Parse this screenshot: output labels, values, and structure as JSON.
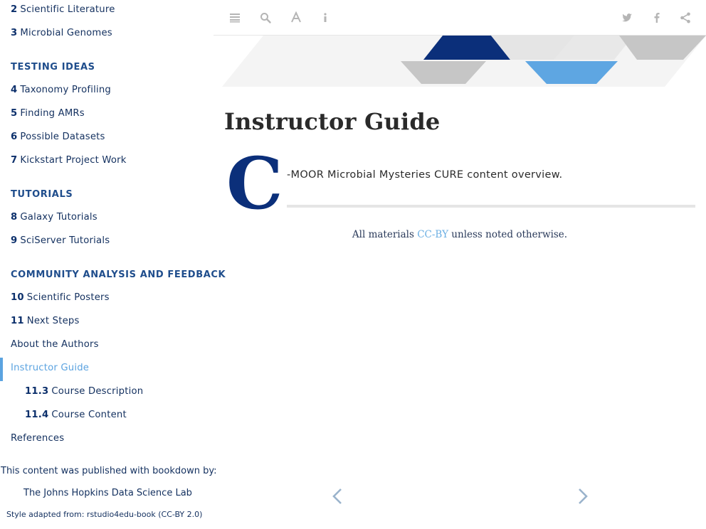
{
  "sidebar": {
    "chapters": [
      {
        "num": "2",
        "label": "Scientific Literature"
      },
      {
        "num": "3",
        "label": "Microbial Genomes"
      }
    ],
    "section_testing": "TESTING IDEAS",
    "testing": [
      {
        "num": "4",
        "label": "Taxonomy Profiling"
      },
      {
        "num": "5",
        "label": "Finding AMRs"
      },
      {
        "num": "6",
        "label": "Possible Datasets"
      },
      {
        "num": "7",
        "label": "Kickstart Project Work"
      }
    ],
    "section_tutorials": "TUTORIALS",
    "tutorials": [
      {
        "num": "8",
        "label": "Galaxy Tutorials"
      },
      {
        "num": "9",
        "label": "SciServer Tutorials"
      }
    ],
    "section_community": "COMMUNITY ANALYSIS AND FEEDBACK",
    "community": [
      {
        "num": "10",
        "label": "Scientific Posters"
      },
      {
        "num": "11",
        "label": "Next Steps"
      }
    ],
    "about": "About the Authors",
    "instructor_guide": "Instructor Guide",
    "subs": [
      {
        "num": "11.3",
        "label": "Course Description"
      },
      {
        "num": "11.4",
        "label": "Course Content"
      }
    ],
    "references": "References",
    "published_with": "This content was published with bookdown by:",
    "jhu": "The Johns Hopkins Data Science Lab",
    "style": "Style adapted from: rstudio4edu-book (CC-BY 2.0)"
  },
  "toolbar": {
    "icons": [
      "menu-icon",
      "search-icon",
      "font-icon",
      "info-icon",
      "twitter-icon",
      "facebook-icon",
      "share-icon"
    ]
  },
  "main": {
    "title": "Instructor Guide",
    "dropcap": "C",
    "lead": "-MOOR Microbial Mysteries CURE content overview.",
    "license_prefix": "All materials ",
    "license_link": "CC-BY",
    "license_suffix": " unless noted otherwise."
  },
  "colors": {
    "navy": "#0b2f7a",
    "accent": "#5ba3e0",
    "gray": "#c9c9c9"
  }
}
